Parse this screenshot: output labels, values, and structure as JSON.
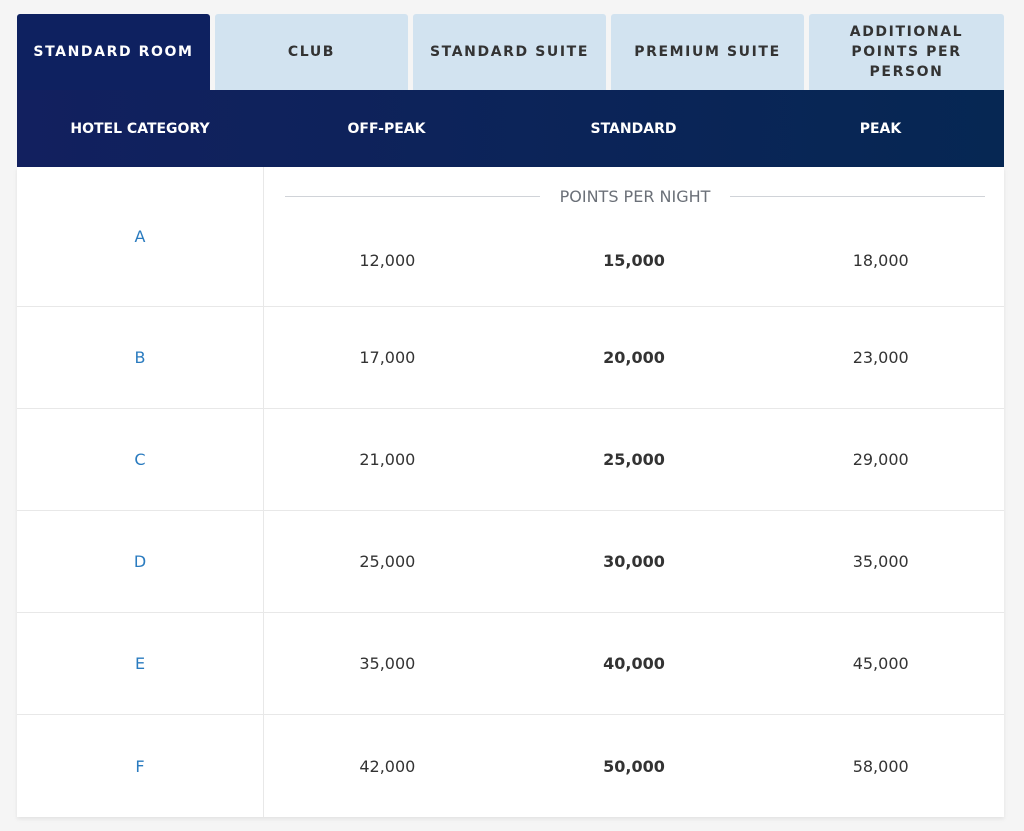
{
  "tabs": [
    {
      "label": "STANDARD ROOM",
      "active": true
    },
    {
      "label": "CLUB",
      "active": false
    },
    {
      "label": "STANDARD SUITE",
      "active": false
    },
    {
      "label": "PREMIUM SUITE",
      "active": false
    },
    {
      "label": "ADDITIONAL POINTS PER PERSON",
      "active": false
    }
  ],
  "table": {
    "headers": [
      "HOTEL CATEGORY",
      "OFF-PEAK",
      "STANDARD",
      "PEAK"
    ],
    "subheader": "POINTS PER NIGHT",
    "rows": [
      {
        "category": "A",
        "off_peak": "12,000",
        "standard": "15,000",
        "peak": "18,000"
      },
      {
        "category": "B",
        "off_peak": "17,000",
        "standard": "20,000",
        "peak": "23,000"
      },
      {
        "category": "C",
        "off_peak": "21,000",
        "standard": "25,000",
        "peak": "29,000"
      },
      {
        "category": "D",
        "off_peak": "25,000",
        "standard": "30,000",
        "peak": "35,000"
      },
      {
        "category": "E",
        "off_peak": "35,000",
        "standard": "40,000",
        "peak": "45,000"
      },
      {
        "category": "F",
        "off_peak": "42,000",
        "standard": "50,000",
        "peak": "58,000"
      }
    ]
  },
  "colors": {
    "active_tab": "#0e2160",
    "inactive_tab": "#d2e3f0",
    "category_link": "#2a7bbf"
  }
}
